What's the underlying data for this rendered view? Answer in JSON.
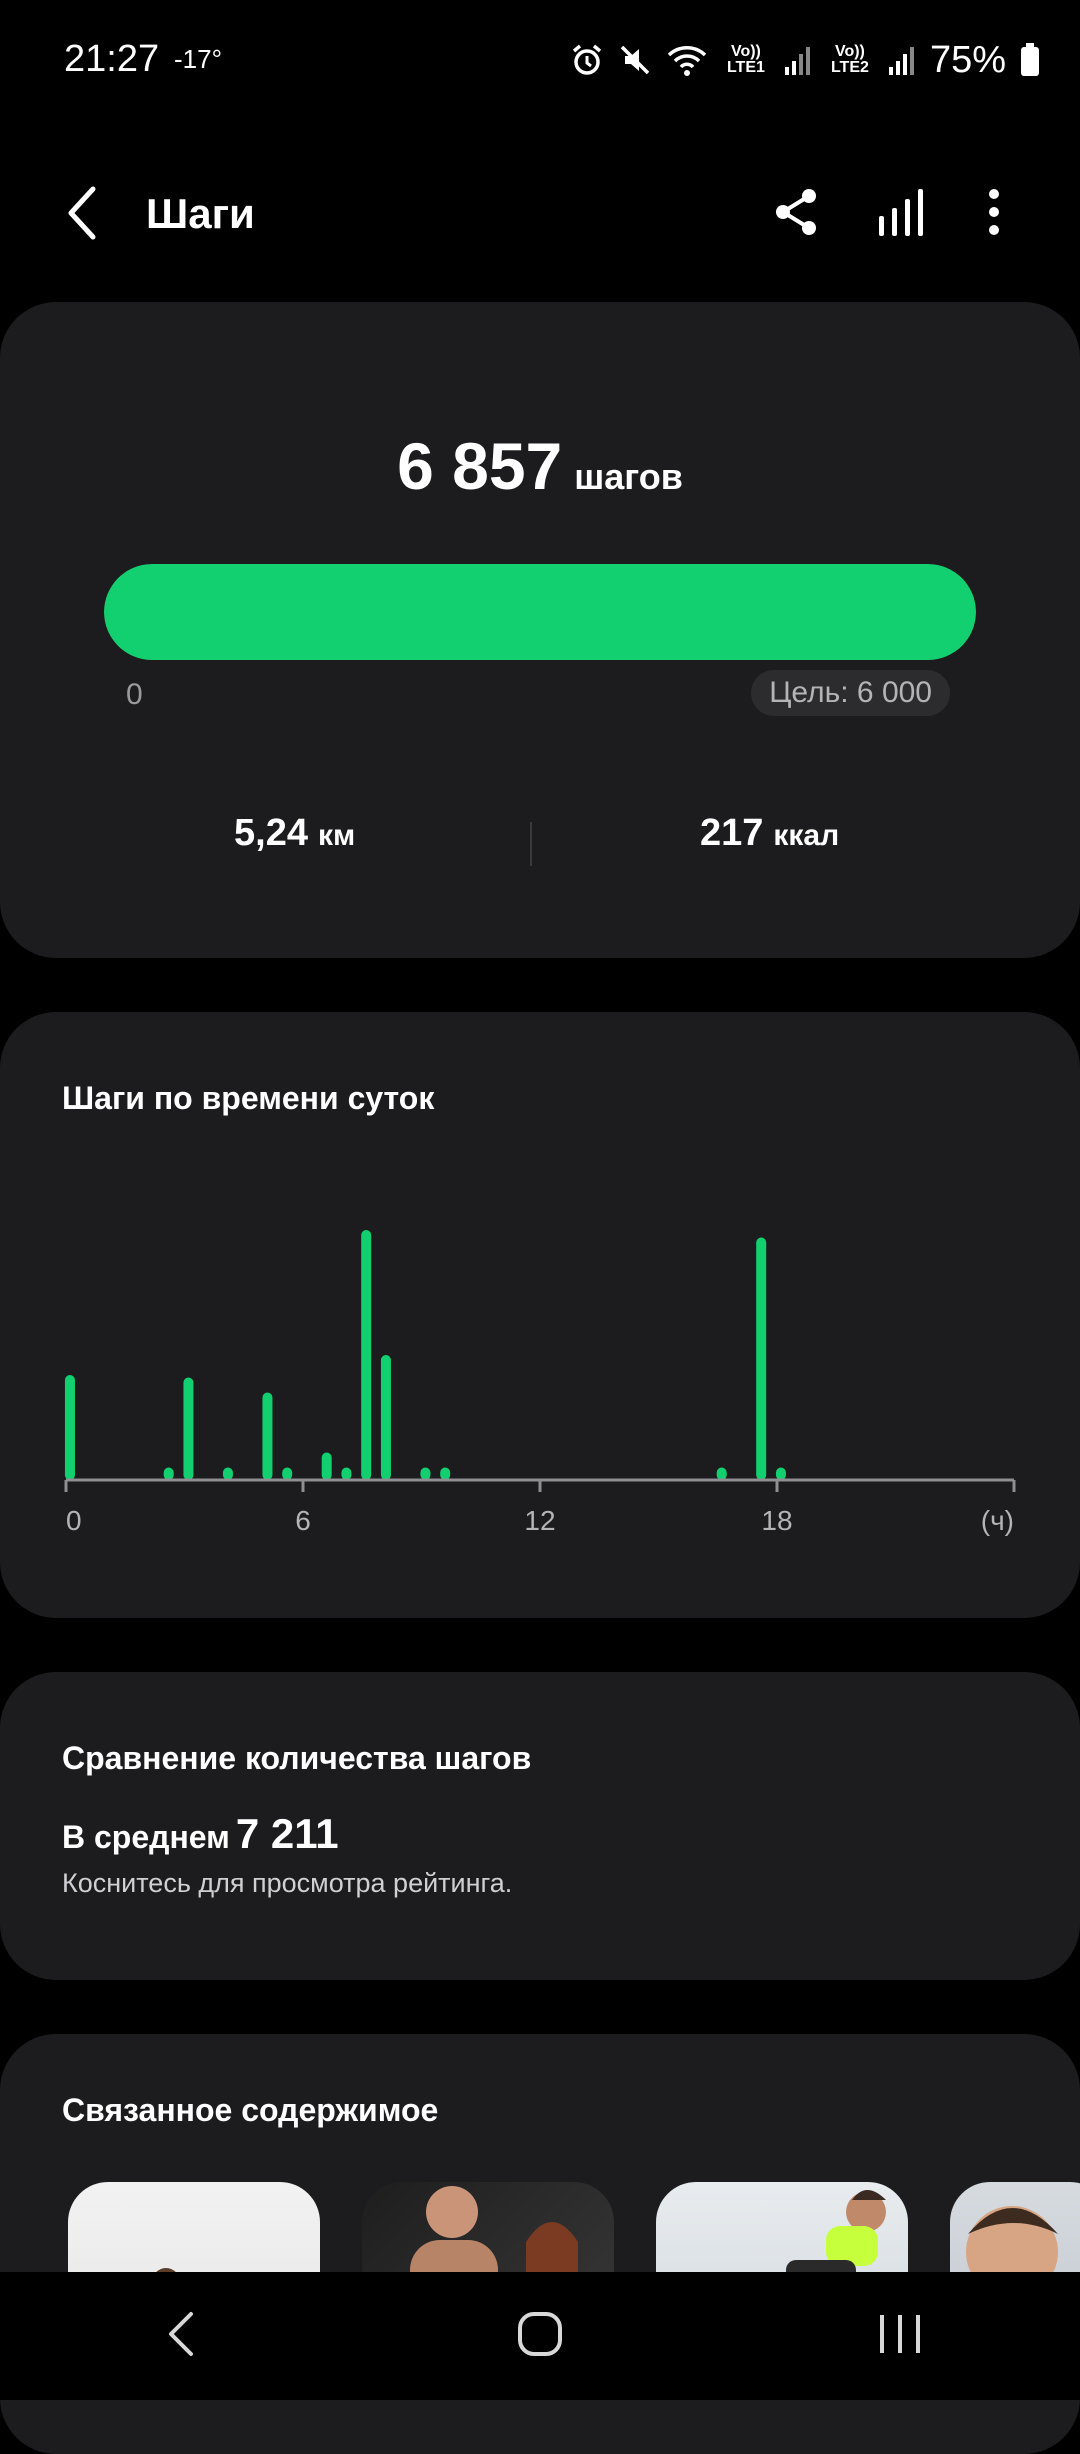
{
  "status": {
    "time": "21:27",
    "temperature": "-17°",
    "sim1_label": "Vo)) LTE1",
    "sim2_label": "Vo)) LTE2",
    "battery_percent": "75%"
  },
  "header": {
    "title": "Шаги",
    "icons": [
      "back-icon",
      "share-icon",
      "bar-chart-icon",
      "more-vert-icon"
    ]
  },
  "summary": {
    "steps_value": "6 857",
    "steps_unit": "шагов",
    "progress_fraction": 1.0,
    "progress_min_label": "0",
    "goal_label": "Цель: 6 000",
    "distance_value": "5,24",
    "distance_unit": "км",
    "calories_value": "217",
    "calories_unit": "ккал"
  },
  "hourly": {
    "title": "Шаги по времени суток",
    "accent_color": "#12d06f"
  },
  "chart_data": {
    "type": "bar",
    "title": "Шаги по времени суток",
    "x_tick_labels": [
      "0",
      "6",
      "12",
      "18"
    ],
    "x_unit_label": "(ч)",
    "xlim": [
      0,
      24
    ],
    "x": [
      0.1,
      2.6,
      3.1,
      4.1,
      5.1,
      5.6,
      6.6,
      7.1,
      7.6,
      8.1,
      9.1,
      9.6,
      16.6,
      17.6,
      18.1
    ],
    "values": [
      42,
      5,
      41,
      5,
      35,
      5,
      11,
      5,
      100,
      50,
      5,
      5,
      5,
      97,
      5
    ],
    "value_scale": "relative, unlabeled",
    "grid": false
  },
  "comparison": {
    "title": "Сравнение количества шагов",
    "avg_label": "В среднем",
    "avg_value": "7 211",
    "hint": "Коснитесь для просмотра рейтинга."
  },
  "related": {
    "title": "Связанное содержимое"
  },
  "navbar": {
    "icons": [
      "nav-back-icon",
      "nav-home-icon",
      "nav-recents-icon"
    ]
  }
}
